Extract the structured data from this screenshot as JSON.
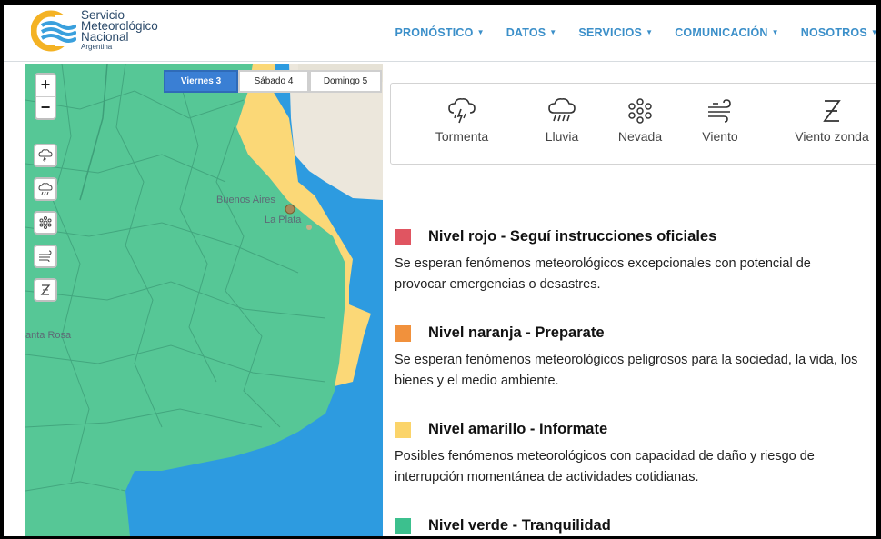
{
  "header": {
    "logo_line1": "Servicio",
    "logo_line2": "Meteorológico",
    "logo_line3": "Nacional",
    "logo_sub": "Argentina",
    "nav": [
      {
        "label": "PRONÓSTICO"
      },
      {
        "label": "DATOS"
      },
      {
        "label": "SERVICIOS"
      },
      {
        "label": "COMUNICACIÓN"
      },
      {
        "label": "NOSOTROS"
      }
    ]
  },
  "map": {
    "zoom_in": "+",
    "zoom_out": "−",
    "days": [
      {
        "label": "Viernes 3",
        "active": true
      },
      {
        "label": "Sábado 4",
        "active": false
      },
      {
        "label": "Domingo 5",
        "active": false
      }
    ],
    "cities": {
      "buenos_aires": "Buenos Aires",
      "la_plata": "La Plata",
      "santa_rosa": "anta Rosa"
    },
    "colors": {
      "green": "#56c796",
      "yellow": "#fbd877",
      "sea": "#2d9be0",
      "land": "#ece7dc"
    }
  },
  "hazards": [
    {
      "icon": "storm-icon",
      "label": "Tormenta"
    },
    {
      "icon": "rain-icon",
      "label": "Lluvia"
    },
    {
      "icon": "snow-icon",
      "label": "Nevada"
    },
    {
      "icon": "wind-icon",
      "label": "Viento"
    },
    {
      "icon": "zonda-wind-icon",
      "label": "Viento zonda"
    }
  ],
  "levels": [
    {
      "color": "#e05561",
      "title": "Nivel rojo - Seguí instrucciones oficiales",
      "desc": "Se esperan fenómenos meteorológicos excepcionales con potencial de provocar emergencias o desastres."
    },
    {
      "color": "#f1913c",
      "title": "Nivel naranja - Preparate",
      "desc": "Se esperan fenómenos meteorológicos peligrosos para la sociedad, la vida, los bienes y el medio ambiente."
    },
    {
      "color": "#fbd46a",
      "title": "Nivel amarillo - Informate",
      "desc": "Posibles fenómenos meteorológicos con capacidad de daño y riesgo de interrupción momentánea de actividades cotidianas."
    },
    {
      "color": "#3cc08e",
      "title": "Nivel verde - Tranquilidad",
      "desc": ""
    }
  ]
}
